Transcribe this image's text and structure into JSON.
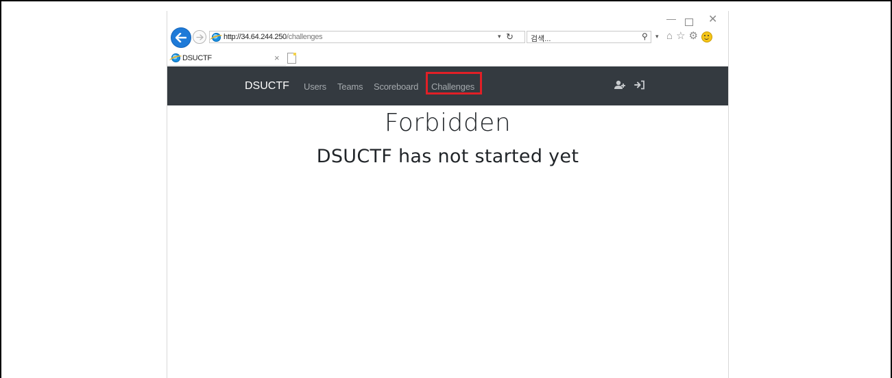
{
  "browser": {
    "url_host": "http://34.64.244.250",
    "url_path": "/challenges",
    "search_placeholder": "검색...",
    "tab_title": "DSUCTF"
  },
  "navbar": {
    "brand": "DSUCTF",
    "links": [
      "Users",
      "Teams",
      "Scoreboard",
      "Challenges"
    ],
    "highlighted_link": "Challenges",
    "highlight_color": "#e21f26",
    "background": "#343a40"
  },
  "main": {
    "title": "Forbidden",
    "message": "DSUCTF has not started yet"
  },
  "icons": {
    "back": "back-arrow-icon",
    "forward": "forward-arrow-icon",
    "refresh": "refresh-icon",
    "search": "search-icon",
    "home": "home-icon",
    "favorites": "star-icon",
    "settings": "gear-icon",
    "feedback": "smiley-icon",
    "register": "user-plus-icon",
    "login": "sign-in-icon"
  }
}
